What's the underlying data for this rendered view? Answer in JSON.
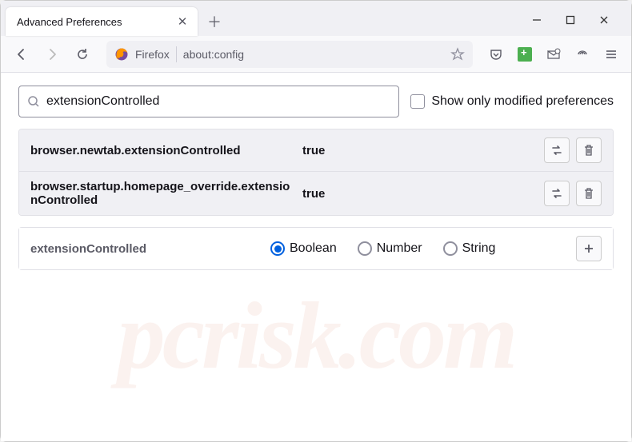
{
  "window": {
    "tab_title": "Advanced Preferences"
  },
  "toolbar": {
    "firefox_label": "Firefox",
    "url": "about:config"
  },
  "search": {
    "value": "extensionControlled",
    "placeholder": "",
    "checkbox_label": "Show only modified preferences"
  },
  "prefs": [
    {
      "name": "browser.newtab.extensionControlled",
      "value": "true"
    },
    {
      "name": "browser.startup.homepage_override.extensionControlled",
      "value": "true"
    }
  ],
  "add_row": {
    "name": "extensionControlled",
    "types": [
      "Boolean",
      "Number",
      "String"
    ],
    "selected": "Boolean"
  },
  "watermark": "pcrisk.com"
}
